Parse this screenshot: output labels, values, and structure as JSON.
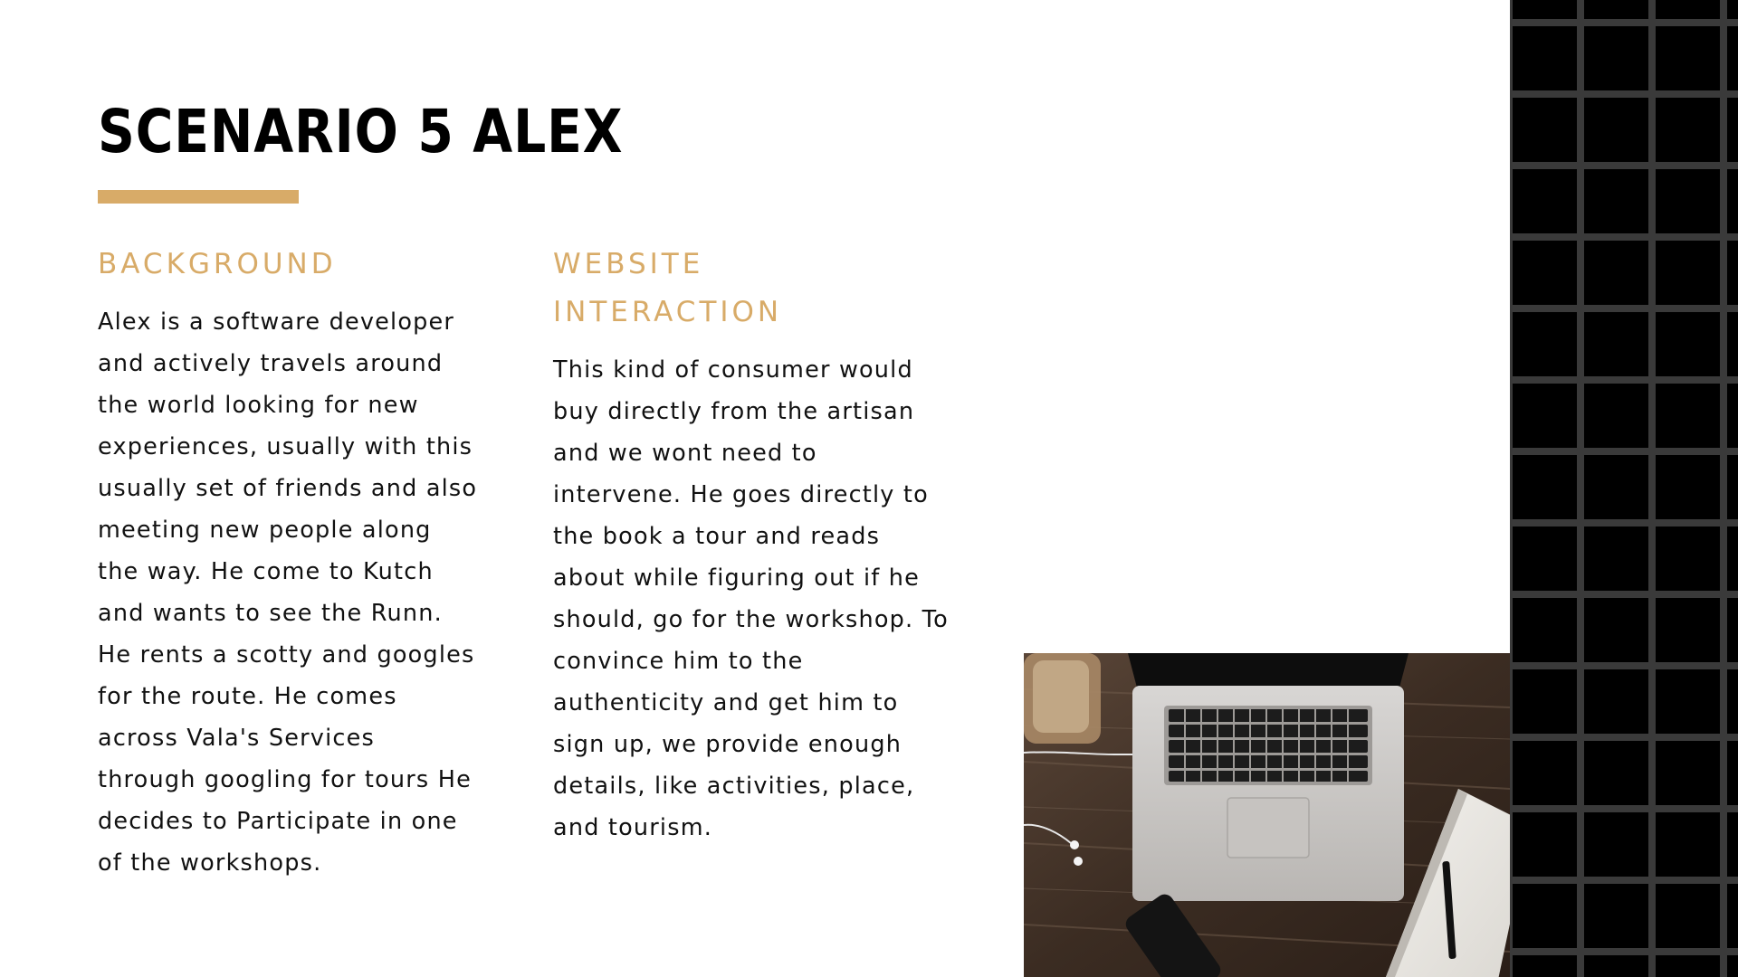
{
  "slide": {
    "title": "SCENARIO 5 ALEX",
    "accent_color": "#d8ab68",
    "background": {
      "heading": "BACKGROUND",
      "body": "Alex is a software developer and actively travels around the world looking for new experiences, usually with this usually set of friends and also meeting new people along the way. He come to Kutch and wants to see the Runn. He rents a scotty and googles for the route. He comes across Vala's Services through googling for tours He decides to Participate in one of the workshops."
    },
    "website_interaction": {
      "heading": "WEBSITE INTERACTION",
      "body": "This kind of consumer would buy directly from the artisan and we wont need to intervene. He goes directly to the book a tour and reads about while figuring out if he should, go for the workshop. To convince him to the authenticity and get him to sign up, we provide enough details, like activities, place, and tourism."
    },
    "photo": {
      "icon": "laptop-desk-photo"
    }
  }
}
